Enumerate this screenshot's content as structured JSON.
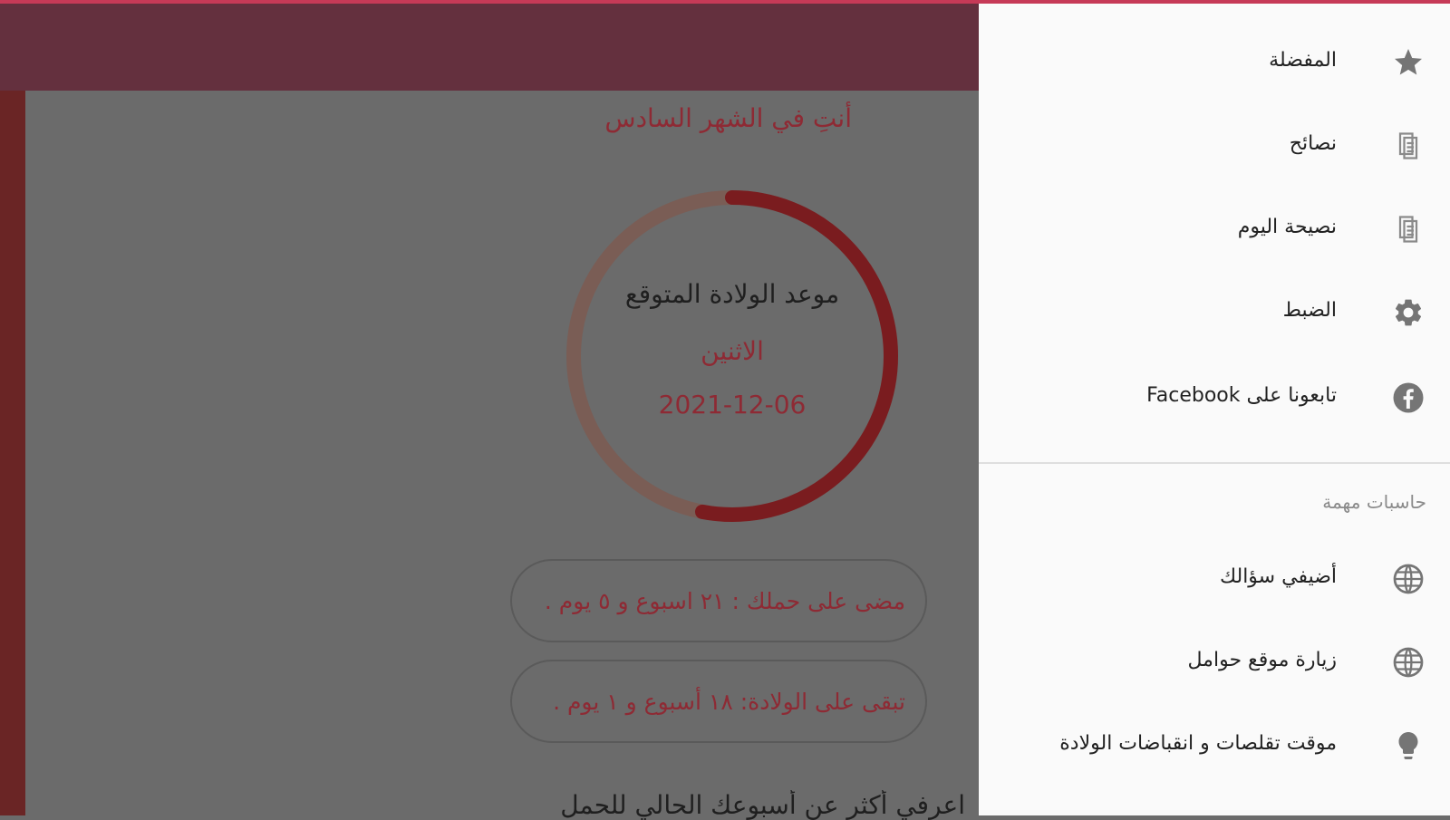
{
  "main": {
    "month_title": "أنتِ في الشهر السادس",
    "due_title": "موعد الولادة المتوقع",
    "due_day": "الاثنين",
    "due_date": "2021-12-06",
    "progress_fraction": 0.53,
    "passed_text": "مضى على حملك : ٢١ اسبوع و ٥ يوم .",
    "remaining_text": "تبقى على الولادة: ١٨ أسبوع و ١ يوم .",
    "bottom_text": "اعرفي أكثر عن أسبوعك الحالي للحمل"
  },
  "drawer": {
    "items": [
      {
        "label": "المفضلة",
        "icon": "star-icon"
      },
      {
        "label": "نصائح",
        "icon": "document-icon"
      },
      {
        "label": "نصيحة اليوم",
        "icon": "document-icon"
      },
      {
        "label": "الضبط",
        "icon": "gear-icon"
      },
      {
        "label": "تابعونا على Facebook",
        "icon": "facebook-icon"
      }
    ],
    "section_label": "حاسبات مهمة",
    "section_items": [
      {
        "label": "أضيفي سؤالك",
        "icon": "globe-icon"
      },
      {
        "label": "زيارة موقع حوامل",
        "icon": "globe-icon"
      },
      {
        "label": "موقت تقلصات و انقباضات الولادة",
        "icon": "lightbulb-icon"
      }
    ]
  },
  "colors": {
    "accent": "#8e2a34",
    "appbar": "#64303e",
    "ring_progress": "#7a1c1f",
    "ring_track": "#7a5d55"
  }
}
